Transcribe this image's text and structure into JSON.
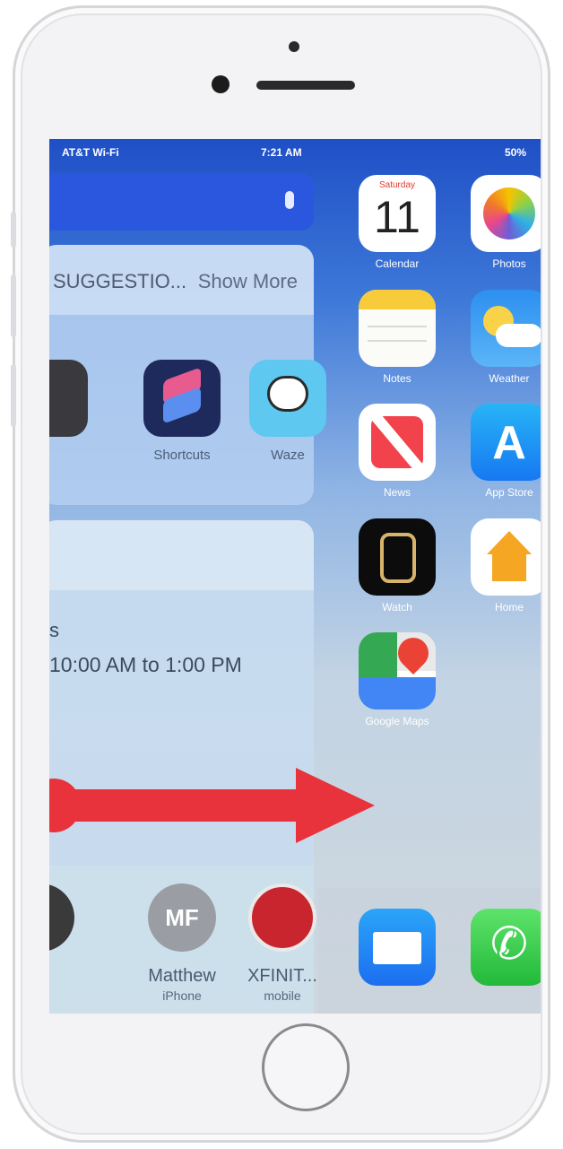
{
  "status_bar": {
    "carrier": "AT&T Wi-Fi",
    "time": "7:21 AM",
    "battery": "50%"
  },
  "today_view": {
    "siri_suggestions": {
      "title": "SUGGESTIO...",
      "show_more": "Show More",
      "apps": [
        {
          "label": "Shortcuts",
          "icon": "shortcuts-icon"
        },
        {
          "label": "Waze",
          "icon": "waze-icon"
        }
      ]
    },
    "calendar_widget": {
      "event_title": "s",
      "event_time": "10:00 AM to 1:00 PM"
    },
    "contacts": [
      {
        "initials": "MF",
        "name": "Matthew",
        "subtitle": "iPhone"
      },
      {
        "initials": "",
        "name": "XFINIT...",
        "subtitle": "mobile"
      }
    ]
  },
  "home_screen": {
    "apps": [
      {
        "label": "Calendar",
        "day_name": "Saturday",
        "day_number": "11",
        "icon": "calendar-icon"
      },
      {
        "label": "Photos",
        "icon": "photos-icon"
      },
      {
        "label": "Notes",
        "icon": "notes-icon"
      },
      {
        "label": "Weather",
        "icon": "weather-icon"
      },
      {
        "label": "News",
        "icon": "news-icon"
      },
      {
        "label": "App Store",
        "icon": "app-store-icon"
      },
      {
        "label": "Watch",
        "icon": "watch-icon"
      },
      {
        "label": "Home",
        "icon": "home-icon"
      },
      {
        "label": "Google Maps",
        "icon": "google-maps-icon"
      }
    ],
    "dock": [
      {
        "label": "Mail",
        "icon": "mail-icon"
      },
      {
        "label": "Phone",
        "icon": "phone-icon"
      }
    ]
  },
  "annotation": {
    "type": "swipe-right-arrow",
    "color": "#e8333d"
  }
}
